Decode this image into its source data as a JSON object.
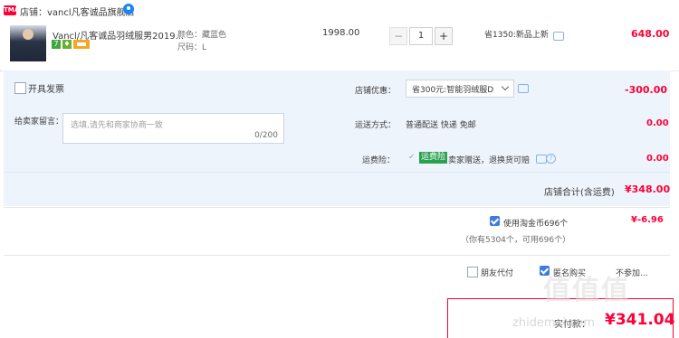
{
  "shop": {
    "badge": "TMALL",
    "label": "店铺：vancl凡客诚品旗舰店"
  },
  "item": {
    "title": "Vancl/凡客诚品羽绒服男2019...",
    "color": "颜色：藏蓝色",
    "size": "尺码：L",
    "unit_price": "1998.00",
    "quantity": "1",
    "minus": "−",
    "plus": "+",
    "promo": "省1350:新品上新",
    "total": "648.00",
    "service_badge_1": "7",
    "service_badge_2": "♦"
  },
  "invoice": {
    "label": "开具发票"
  },
  "coupon": {
    "label": "店铺优惠：",
    "selected": "省300元:智能羽绒服D",
    "value": "-300.00"
  },
  "message": {
    "label": "给卖家留言：",
    "placeholder": "选填,请先和商家协商一致",
    "counter": "0/200"
  },
  "shipping": {
    "label": "运送方式：",
    "value": "普通配送 快递 免邮",
    "price": "0.00"
  },
  "insurance": {
    "label": "运费险：",
    "check": "✓",
    "badge": "运费险",
    "text": "卖家赠送，退换货可赔",
    "help": "?",
    "price": "0.00"
  },
  "subtotal": {
    "label": "店铺合计(含运费)",
    "value": "¥348.00"
  },
  "coins": {
    "label": "使用淘金币696个",
    "value": "¥-6.96",
    "info": "（你有5304个，可用696个）"
  },
  "options": {
    "friend_pay": "朋友代付",
    "anonymous": "匿名购买",
    "more": "不参加..."
  },
  "final": {
    "label": "实付款：",
    "amount": "¥341.04"
  },
  "watermark": {
    "text": "值值值",
    "url": "zhidemai.com"
  },
  "colors": {
    "accent_red": "#ff0036",
    "blue_bg": "#eef4fc",
    "check_blue": "#3e7ce0",
    "green_badge": "#2aa14f"
  }
}
